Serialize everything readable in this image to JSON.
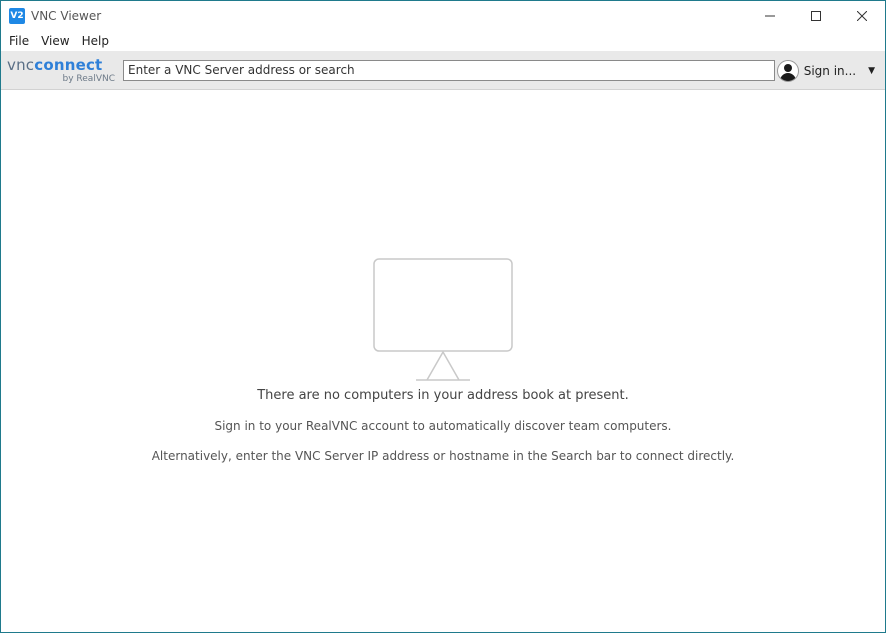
{
  "window": {
    "title": "VNC Viewer",
    "icon_text": "V2"
  },
  "menu": {
    "items": [
      "File",
      "View",
      "Help"
    ]
  },
  "toolbar": {
    "logo_vnc": "vnc",
    "logo_connect": "connect",
    "logo_sub": "by RealVNC",
    "search_placeholder": "Enter a VNC Server address or search",
    "signin_label": "Sign in..."
  },
  "main": {
    "empty_title": "There are no computers in your address book at present.",
    "line1": "Sign in to your RealVNC account to automatically discover team computers.",
    "line2": "Alternatively, enter the VNC Server IP address or hostname in the Search bar to connect directly."
  },
  "colors": {
    "accent": "#2f80d8",
    "border": "#1f7a8c"
  }
}
